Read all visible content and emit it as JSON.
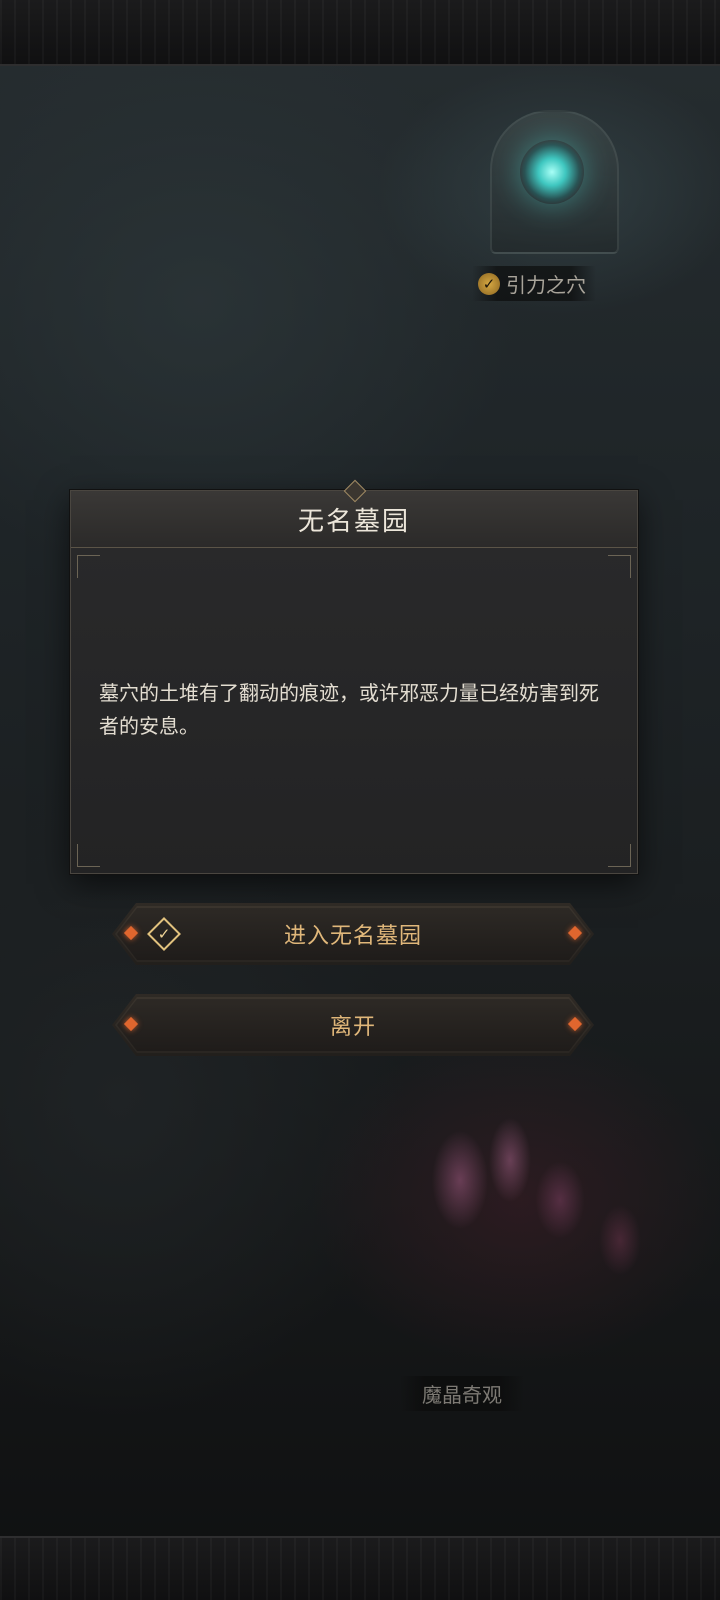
{
  "map": {
    "portal_label": "引力之穴",
    "crystal_label": "魔晶奇观"
  },
  "dialog": {
    "title": "无名墓园",
    "body": "墓穴的土堆有了翻动的痕迹，或许邪恶力量已经妨害到死者的安息。"
  },
  "actions": {
    "enter_label": "进入无名墓园",
    "leave_label": "离开"
  },
  "colors": {
    "button_text": "#e0b77a",
    "gem_accent": "#e0662e",
    "portal_glow": "#3fc7c0"
  }
}
